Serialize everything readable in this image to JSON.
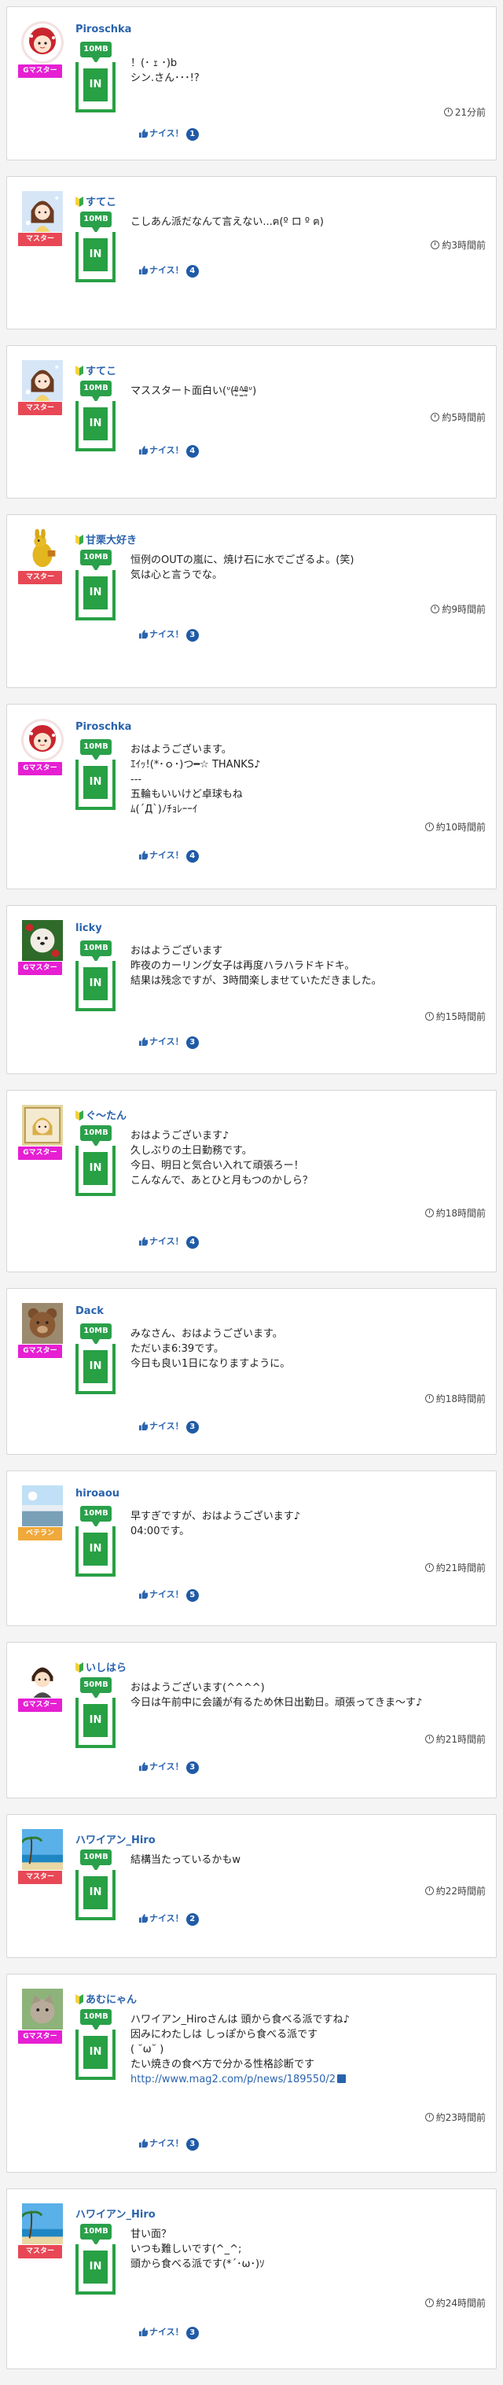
{
  "labels": {
    "nice": "ナイス！"
  },
  "colors": {
    "master": "#e84855",
    "gmaster": "#e61fd3",
    "beginner": "#f0a93a",
    "in": "#28a044",
    "link": "#2a63ad"
  },
  "posts": [
    {
      "name": "Piroschka",
      "badge": "Gマスター",
      "badge_type": "gmaster",
      "mb": "10MB",
      "message": "！(･ ｪ ･)b\nシン.さん･･･!?",
      "time": "21分前",
      "nice": "1",
      "beginner": false,
      "avatar": "girl-red"
    },
    {
      "name": "すてこ",
      "badge": "マスター",
      "badge_type": "master",
      "mb": "10MB",
      "message": "こしあん派だなんて言えない...ฅ(º ロ º ฅ)",
      "time": "約3時間前",
      "nice": "4",
      "beginner": true,
      "avatar": "girl-brown"
    },
    {
      "name": "すてこ",
      "badge": "マスター",
      "badge_type": "master",
      "mb": "10MB",
      "message": "マススタート面白い(ᐡ(ᶿ̴̴͈ᐞ̫ᶿ̴̴͈ᐡ)",
      "time": "約5時間前",
      "nice": "4",
      "beginner": true,
      "avatar": "girl-brown"
    },
    {
      "name": "甘栗大好き",
      "badge": "マスター",
      "badge_type": "master",
      "mb": "10MB",
      "message": "恒例のOUTの嵐に、焼け石に水でござるよ。(笑)\n気は心と言うでな。",
      "time": "約9時間前",
      "nice": "3",
      "beginner": true,
      "avatar": "kangaroo"
    },
    {
      "name": "Piroschka",
      "badge": "Gマスター",
      "badge_type": "gmaster",
      "mb": "10MB",
      "message": "おはようございます。\nｴｲｯ!(*･ｏ･)つ━☆ THANKS♪\n---\n五輪もいいけど卓球もね\nﾑ(´Д`)ﾉﾁｮﾚｰｰｲ",
      "time": "約10時間前",
      "nice": "4",
      "beginner": false,
      "avatar": "girl-red"
    },
    {
      "name": "licky",
      "badge": "Gマスター",
      "badge_type": "gmaster",
      "mb": "10MB",
      "message": "おはようございます\n昨夜のカーリング女子は再度ハラハラドキドキ。\n結果は残念ですが、3時間楽しませていただきました。",
      "time": "約15時間前",
      "nice": "3",
      "beginner": false,
      "avatar": "dog"
    },
    {
      "name": "ぐ〜たん",
      "badge": "Gマスター",
      "badge_type": "gmaster",
      "mb": "10MB",
      "message": "おはようございます♪\n久しぶりの土日勤務です。\n今日、明日と気合い入れて頑張ろー！\nこんなんで、あとひと月もつのかしら？",
      "time": "約18時間前",
      "nice": "4",
      "beginner": true,
      "avatar": "cartoon"
    },
    {
      "name": "Dack",
      "badge": "Gマスター",
      "badge_type": "gmaster",
      "mb": "10MB",
      "message": "みなさん、おはようございます。\nただいま6:39です。\n今日も良い1日になりますように。",
      "time": "約18時間前",
      "nice": "3",
      "beginner": false,
      "avatar": "bear"
    },
    {
      "name": "hiroaou",
      "badge": "ベテラン",
      "badge_type": "beginner",
      "mb": "10MB",
      "message": "早すぎですが、おはようございます♪\n04:00です。",
      "time": "約21時間前",
      "nice": "5",
      "beginner": false,
      "avatar": "sky"
    },
    {
      "name": "いしはら",
      "badge": "Gマスター",
      "badge_type": "gmaster",
      "mb": "50MB",
      "message": "おはようございます(^^^^)\n今日は午前中に会議が有るため休日出勤日。頑張ってきま〜す♪",
      "time": "約21時間前",
      "nice": "3",
      "beginner": true,
      "avatar": "boy"
    },
    {
      "name": "ハワイアン_Hiro",
      "badge": "マスター",
      "badge_type": "master",
      "mb": "10MB",
      "message": "結構当たっているかもw",
      "time": "約22時間前",
      "nice": "2",
      "beginner": false,
      "avatar": "beach"
    },
    {
      "name": "あむにゃん",
      "badge": "Gマスター",
      "badge_type": "gmaster",
      "mb": "10MB",
      "message": "ハワイアン_Hiroさんは 頭から食べる派ですね♪\n因みにわたしは しっぽから食べる派です\n( ˘ω˘ )\nたい焼きの食べ方で分かる性格診断です",
      "link": "http://www.mag2.com/p/news/189550/2",
      "time": "約23時間前",
      "nice": "3",
      "beginner": true,
      "avatar": "cat"
    },
    {
      "name": "ハワイアン_Hiro",
      "badge": "マスター",
      "badge_type": "master",
      "mb": "10MB",
      "message": "甘い面？\nいつも難しいです(^_^;\n頭から食べる派です(*´･ω･)ｿ",
      "time": "約24時間前",
      "nice": "3",
      "beginner": false,
      "avatar": "beach"
    }
  ]
}
